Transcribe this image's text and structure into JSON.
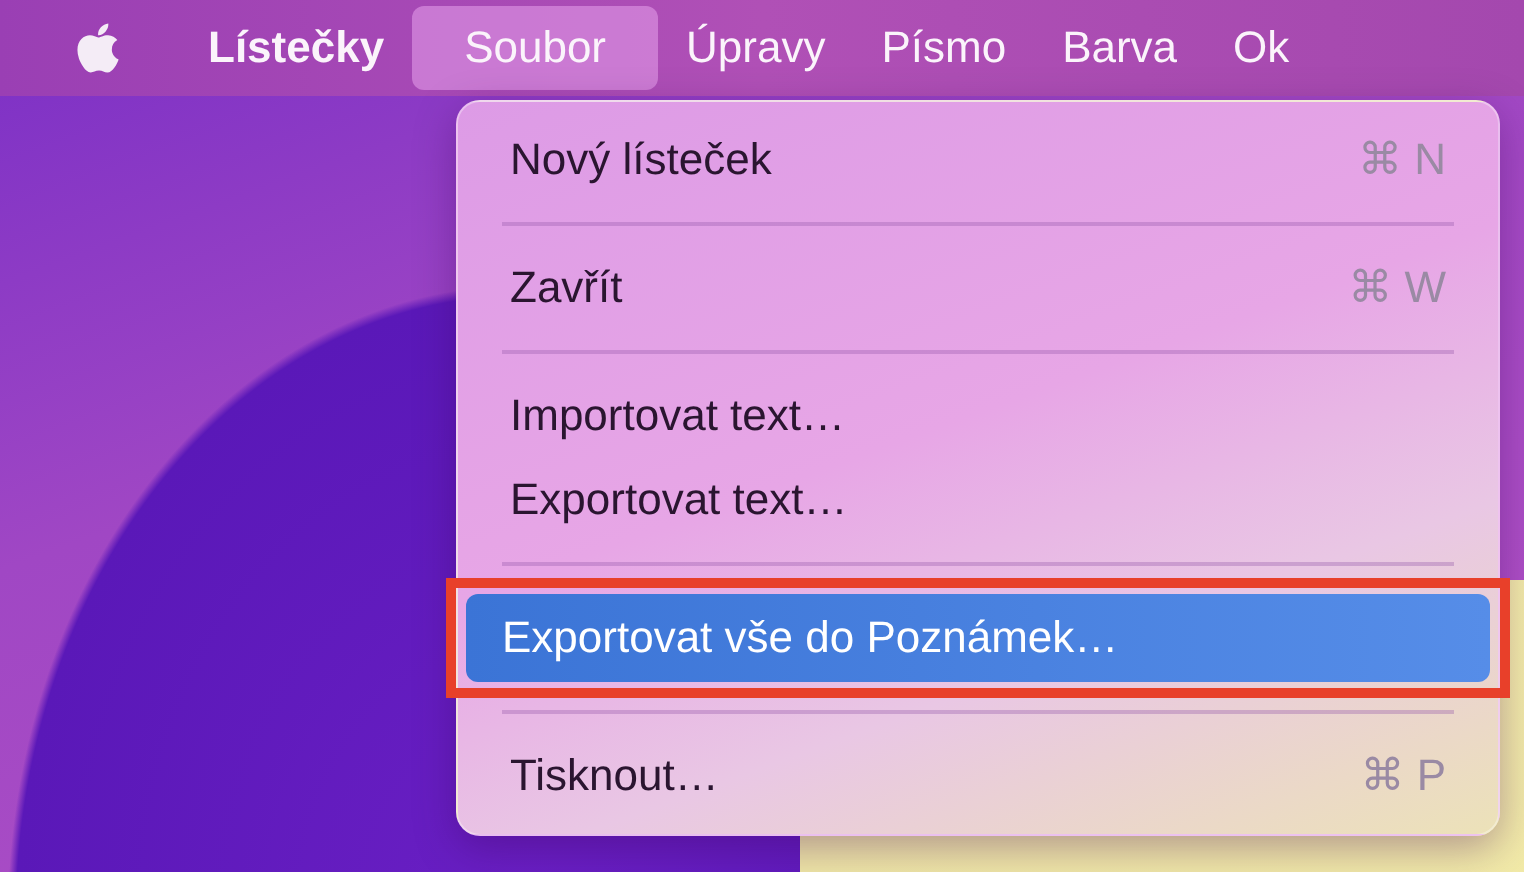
{
  "menu_bar": {
    "items": [
      {
        "label": "Lístečky",
        "kind": "app",
        "selected": false
      },
      {
        "label": "Soubor",
        "kind": "menu",
        "selected": true
      },
      {
        "label": "Úpravy",
        "kind": "menu",
        "selected": false
      },
      {
        "label": "Písmo",
        "kind": "menu",
        "selected": false
      },
      {
        "label": "Barva",
        "kind": "menu",
        "selected": false
      },
      {
        "label": "Ok",
        "kind": "menu",
        "selected": false
      }
    ]
  },
  "dropdown": {
    "items": [
      {
        "kind": "item",
        "label": "Nový lísteček",
        "shortcut": "⌘ N",
        "selected": false,
        "annotated": false
      },
      {
        "kind": "separator"
      },
      {
        "kind": "item",
        "label": "Zavřít",
        "shortcut": "⌘ W",
        "selected": false,
        "annotated": false
      },
      {
        "kind": "separator"
      },
      {
        "kind": "item",
        "label": "Importovat text…",
        "selected": false,
        "annotated": false
      },
      {
        "kind": "item",
        "label": "Exportovat text…",
        "selected": false,
        "annotated": false
      },
      {
        "kind": "separator"
      },
      {
        "kind": "item",
        "label": "Exportovat vše do Poznámek…",
        "selected": true,
        "annotated": true
      },
      {
        "kind": "separator"
      },
      {
        "kind": "item",
        "label": "Tisknout…",
        "shortcut": "⌘ P",
        "selected": false,
        "annotated": false
      }
    ]
  }
}
